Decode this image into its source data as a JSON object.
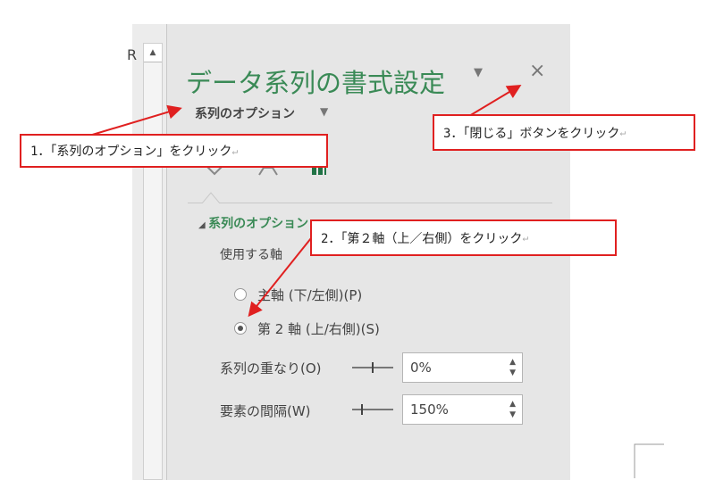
{
  "panel": {
    "title": "データ系列の書式設定",
    "close_icon": "×",
    "subtitle": "系列のオプション",
    "section": "系列のオプション",
    "axis_label": "使用する軸",
    "primary_axis": "主軸 (下/左側)(P)",
    "secondary_axis": "第 2 軸 (上/右側)(S)",
    "selected_axis": "secondary",
    "overlap_label": "系列の重なり(O)",
    "overlap_value": "0%",
    "gap_label": "要素の間隔(W)",
    "gap_value": "150%"
  },
  "sheet": {
    "cell_char": "R"
  },
  "callouts": {
    "step1": "1．「系列のオプション」をクリック",
    "step2": "2．「第２軸（上／右側）をクリック",
    "step3": "3．「閉じる」ボタンをクリック",
    "return_mark": "↵"
  },
  "colors": {
    "accent": "#3a8a56",
    "callout_border": "#e02020"
  }
}
